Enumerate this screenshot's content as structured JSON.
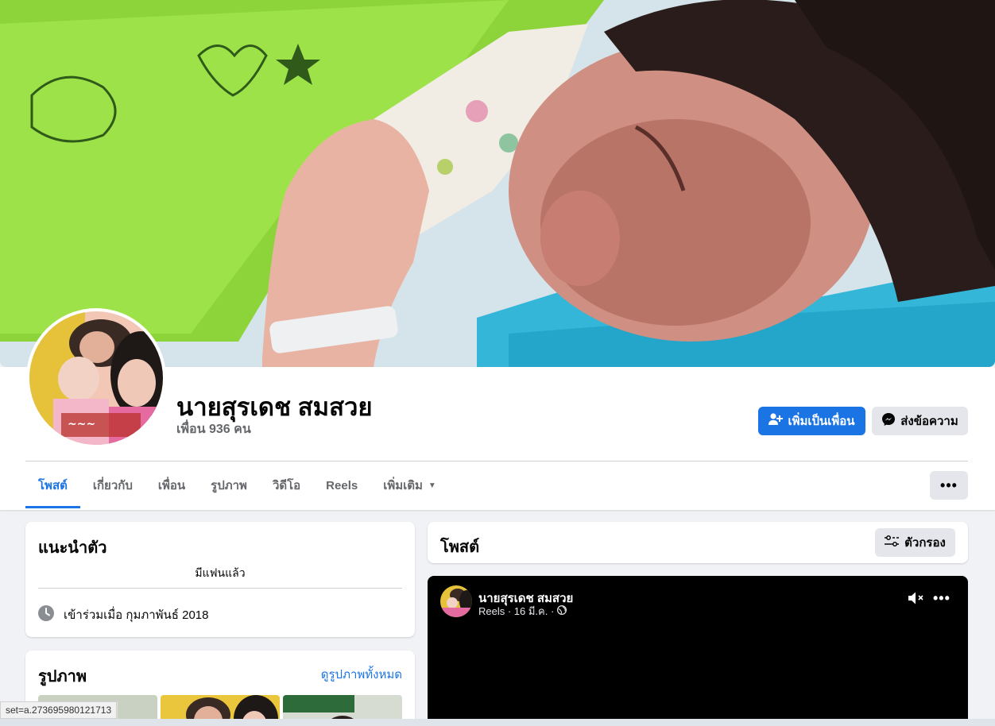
{
  "profile": {
    "name": "นายสุรเดช สมสวย",
    "friends_text": "เพื่อน 936 คน"
  },
  "actions": {
    "add_friend_label": "เพิ่มเป็นเพื่อน",
    "message_label": "ส่งข้อความ",
    "more_label": "•••"
  },
  "tabs": [
    {
      "label": "โพสต์",
      "active": true
    },
    {
      "label": "เกี่ยวกับ"
    },
    {
      "label": "เพื่อน"
    },
    {
      "label": "รูปภาพ"
    },
    {
      "label": "วิดีโอ"
    },
    {
      "label": "Reels"
    },
    {
      "label": "เพิ่มเติม"
    }
  ],
  "intro": {
    "title": "แนะนำตัว",
    "bio": "มีแฟนแล้ว",
    "joined": "เข้าร่วมเมื่อ กุมภาพันธ์ 2018"
  },
  "photos": {
    "title": "รูปภาพ",
    "see_all": "ดูรูปภาพทั้งหมด"
  },
  "posts": {
    "title": "โพสต์",
    "filter_label": "ตัวกรอง"
  },
  "reel_post": {
    "author": "นายสุรเดช สมสวย",
    "meta": "Reels · 16 มี.ค. ·"
  },
  "status_bar": {
    "url_text": "set=a.273695980121713"
  },
  "colors": {
    "accent": "#1b74e4",
    "background": "#f0f2f5",
    "secondary_button": "#e4e6eb"
  }
}
